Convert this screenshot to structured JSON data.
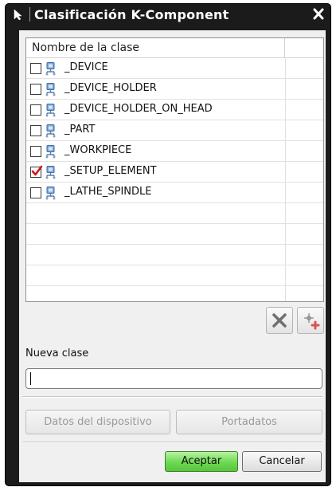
{
  "window": {
    "title": "Clasificación K-Component",
    "app_icon": "cursor-arrow-icon",
    "close_icon": "close-icon"
  },
  "list": {
    "column_header": "Nombre de la clase",
    "item_icon": "component-class-icon",
    "items": [
      {
        "label": "_DEVICE",
        "checked": false
      },
      {
        "label": "_DEVICE_HOLDER",
        "checked": false
      },
      {
        "label": "_DEVICE_HOLDER_ON_HEAD",
        "checked": false
      },
      {
        "label": "_PART",
        "checked": false
      },
      {
        "label": "_WORKPIECE",
        "checked": false
      },
      {
        "label": "_SETUP_ELEMENT",
        "checked": true
      },
      {
        "label": "_LATHE_SPINDLE",
        "checked": false
      }
    ]
  },
  "toolbar": {
    "delete_icon": "delete-x-icon",
    "add_icon": "add-class-icon"
  },
  "new_class": {
    "label": "Nueva clase",
    "value": ""
  },
  "buttons": {
    "device_data": "Datos del dispositivo",
    "data_carrier": "Portadatos",
    "accept": "Aceptar",
    "cancel": "Cancelar"
  },
  "colors": {
    "checkmark": "#d01818",
    "accept_button": "#6ed852",
    "titlebar": "#1b1b1b"
  }
}
